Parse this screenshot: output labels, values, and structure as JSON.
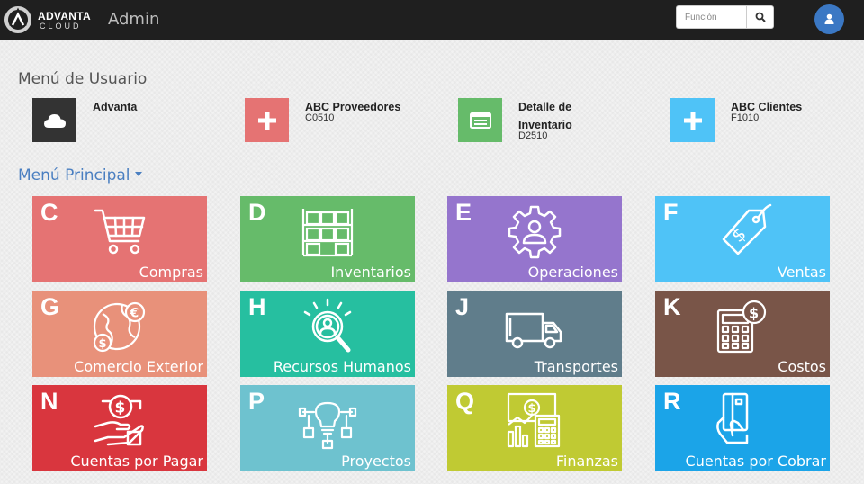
{
  "topbar": {
    "logo_line1": "ADVANTA",
    "logo_line2": "CLOUD",
    "app_title": "Admin",
    "search_placeholder": "Función",
    "search_icon": "search-icon",
    "user_icon": "user-icon"
  },
  "user_menu": {
    "title": "Menú de Usuario",
    "items": [
      {
        "name": "Advanta",
        "code": "",
        "color": "#333333",
        "icon": "cloud-icon"
      },
      {
        "name": "ABC Proveedores",
        "code": "C0510",
        "color": "#e57373",
        "icon": "plus-icon"
      },
      {
        "name": "Detalle de Inventario",
        "code": "D2510",
        "color": "#66bb6a",
        "icon": "list-window-icon"
      },
      {
        "name": "ABC Clientes",
        "code": "F1010",
        "color": "#4fc3f7",
        "icon": "plus-icon"
      }
    ]
  },
  "main_menu": {
    "title": "Menú Principal",
    "tiles": [
      {
        "letter": "C",
        "label": "Compras",
        "color": "#e57373",
        "icon": "shopping-cart-icon"
      },
      {
        "letter": "D",
        "label": "Inventarios",
        "color": "#66bb6a",
        "icon": "warehouse-shelves-icon"
      },
      {
        "letter": "E",
        "label": "Operaciones",
        "color": "#9575cd",
        "icon": "gear-person-icon"
      },
      {
        "letter": "F",
        "label": "Ventas",
        "color": "#4fc3f7",
        "icon": "price-tag-icon"
      },
      {
        "letter": "G",
        "label": "Comercio Exterior",
        "color": "#e8917a",
        "icon": "globe-currency-icon"
      },
      {
        "letter": "H",
        "label": "Recursos Humanos",
        "color": "#26bfa0",
        "icon": "magnifier-person-icon"
      },
      {
        "letter": "J",
        "label": "Transportes",
        "color": "#607d8b",
        "icon": "truck-icon"
      },
      {
        "letter": "K",
        "label": "Costos",
        "color": "#795548",
        "icon": "calculator-coin-icon"
      },
      {
        "letter": "N",
        "label": "Cuentas por Pagar",
        "color": "#d9363e",
        "icon": "hand-money-icon"
      },
      {
        "letter": "P",
        "label": "Proyectos",
        "color": "#6ec2cf",
        "icon": "lightbulb-plan-icon"
      },
      {
        "letter": "Q",
        "label": "Finanzas",
        "color": "#c0ca33",
        "icon": "finance-chart-icon"
      },
      {
        "letter": "R",
        "label": "Cuentas por Cobrar",
        "color": "#1ba4e8",
        "icon": "hand-card-icon"
      }
    ]
  }
}
